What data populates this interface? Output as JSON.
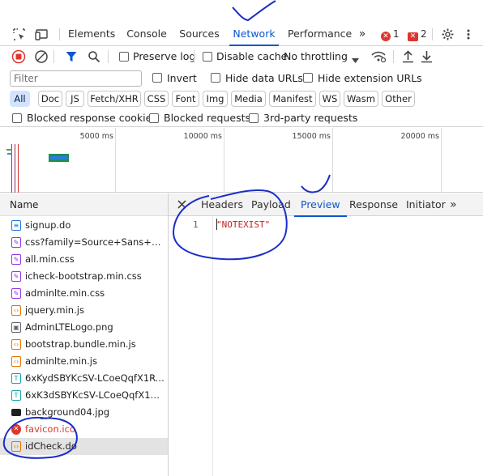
{
  "top_tabs": [
    "Elements",
    "Console",
    "Sources",
    "Network",
    "Performance"
  ],
  "active_tab": "Network",
  "overflow_glyph": "»",
  "error_count": "1",
  "issue_count": "2",
  "toolbar": {
    "preserve_log": "Preserve log",
    "disable_cache": "Disable cache",
    "throttling": "No throttling"
  },
  "filter": {
    "placeholder": "Filter",
    "invert": "Invert",
    "hide_data_urls": "Hide data URLs",
    "hide_extension_urls": "Hide extension URLs"
  },
  "type_chips": [
    "All",
    "Doc",
    "JS",
    "Fetch/XHR",
    "CSS",
    "Font",
    "Img",
    "Media",
    "Manifest",
    "WS",
    "Wasm",
    "Other"
  ],
  "active_chip": "All",
  "blocked": {
    "blocked_cookies": "Blocked response cookies",
    "blocked_requests": "Blocked requests",
    "third_party": "3rd-party requests"
  },
  "overview_ticks": [
    "5000 ms",
    "10000 ms",
    "15000 ms",
    "20000 ms"
  ],
  "requests": {
    "header": "Name",
    "items": [
      {
        "name": "signup.do",
        "type": "doc",
        "color": "#1a73e8"
      },
      {
        "name": "css?family=Source+Sans+Pro:...",
        "type": "css",
        "color": "#9334e6"
      },
      {
        "name": "all.min.css",
        "type": "css",
        "color": "#9334e6"
      },
      {
        "name": "icheck-bootstrap.min.css",
        "type": "css",
        "color": "#9334e6"
      },
      {
        "name": "adminlte.min.css",
        "type": "css",
        "color": "#9334e6"
      },
      {
        "name": "jquery.min.js",
        "type": "js",
        "color": "#e37400"
      },
      {
        "name": "AdminLTELogo.png",
        "type": "img",
        "color": "#5f6368"
      },
      {
        "name": "bootstrap.bundle.min.js",
        "type": "js",
        "color": "#e37400"
      },
      {
        "name": "adminlte.min.js",
        "type": "js",
        "color": "#e37400"
      },
      {
        "name": "6xKydSBYKcSV-LCoeQqfX1RY...",
        "type": "font",
        "color": "#12a4af"
      },
      {
        "name": "6xK3dSBYKcSV-LCoeQqfX1RY...",
        "type": "font",
        "color": "#12a4af"
      },
      {
        "name": "background04.jpg",
        "type": "img",
        "color": "#1f1f1f"
      },
      {
        "name": "favicon.ico",
        "type": "error",
        "color": "#dc362e"
      },
      {
        "name": "idCheck.do",
        "type": "xhr",
        "color": "#e37400"
      }
    ]
  },
  "detail_tabs": [
    "Headers",
    "Payload",
    "Preview",
    "Response",
    "Initiator"
  ],
  "active_detail_tab": "Preview",
  "preview": {
    "line_number": "1",
    "content": "\"NOTEXIST\""
  },
  "colors": {
    "accent": "#0b57d0",
    "error": "#dc362e",
    "annotation_ink": "#1a2ec9"
  }
}
